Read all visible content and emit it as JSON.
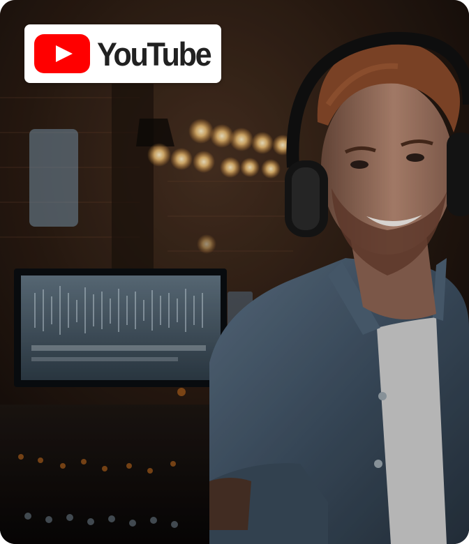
{
  "badge": {
    "wordmark": "YouTube",
    "icon": "youtube-play-icon",
    "icon_color": "#ff0000"
  },
  "photo": {
    "subject": "smiling-man-with-headphones",
    "setting": "music-studio"
  }
}
